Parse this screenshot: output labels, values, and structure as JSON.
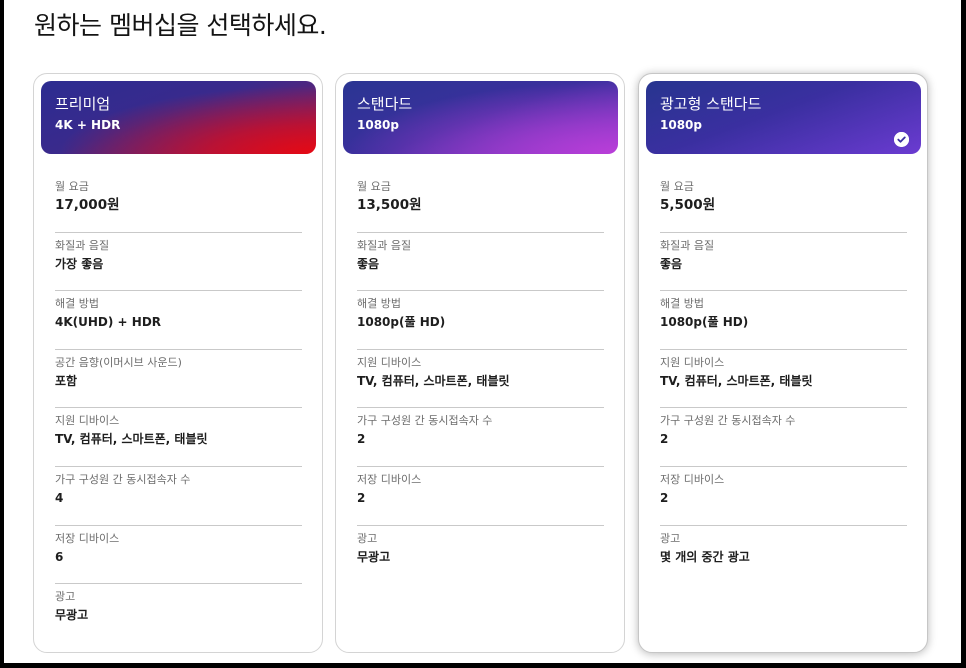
{
  "page": {
    "title": "원하는 멤버십을 선택하세요."
  },
  "plans": [
    {
      "name": "프리미엄",
      "resolution": "4K + HDR",
      "selected": false,
      "specs": [
        {
          "label": "월 요금",
          "value": "17,000원"
        },
        {
          "label": "화질과 음질",
          "value": "가장 좋음"
        },
        {
          "label": "해결 방법",
          "value": "4K(UHD) + HDR"
        },
        {
          "label": "공간 음향(이머시브 사운드)",
          "value": "포함"
        },
        {
          "label": "지원 디바이스",
          "value": "TV, 컴퓨터, 스마트폰, 태블릿"
        },
        {
          "label": "가구 구성원 간 동시접속자 수",
          "value": "4"
        },
        {
          "label": "저장 디바이스",
          "value": "6"
        },
        {
          "label": "광고",
          "value": "무광고"
        }
      ]
    },
    {
      "name": "스탠다드",
      "resolution": "1080p",
      "selected": false,
      "specs": [
        {
          "label": "월 요금",
          "value": "13,500원"
        },
        {
          "label": "화질과 음질",
          "value": "좋음"
        },
        {
          "label": "해결 방법",
          "value": "1080p(풀 HD)"
        },
        {
          "label": "지원 디바이스",
          "value": "TV, 컴퓨터, 스마트폰, 태블릿"
        },
        {
          "label": "가구 구성원 간 동시접속자 수",
          "value": "2"
        },
        {
          "label": "저장 디바이스",
          "value": "2"
        },
        {
          "label": "광고",
          "value": "무광고"
        }
      ]
    },
    {
      "name": "광고형 스탠다드",
      "resolution": "1080p",
      "selected": true,
      "specs": [
        {
          "label": "월 요금",
          "value": "5,500원"
        },
        {
          "label": "화질과 음질",
          "value": "좋음"
        },
        {
          "label": "해결 방법",
          "value": "1080p(풀 HD)"
        },
        {
          "label": "지원 디바이스",
          "value": "TV, 컴퓨터, 스마트폰, 태블릿"
        },
        {
          "label": "가구 구성원 간 동시접속자 수",
          "value": "2"
        },
        {
          "label": "저장 디바이스",
          "value": "2"
        },
        {
          "label": "광고",
          "value": "몇 개의 중간 광고"
        }
      ]
    }
  ],
  "icons": {
    "selected_indicator": "check-circle-icon"
  },
  "colors": {
    "premium_accent": "#e50914",
    "standard_accent": "#b93ed8",
    "ads_accent": "#6b3bd1"
  }
}
